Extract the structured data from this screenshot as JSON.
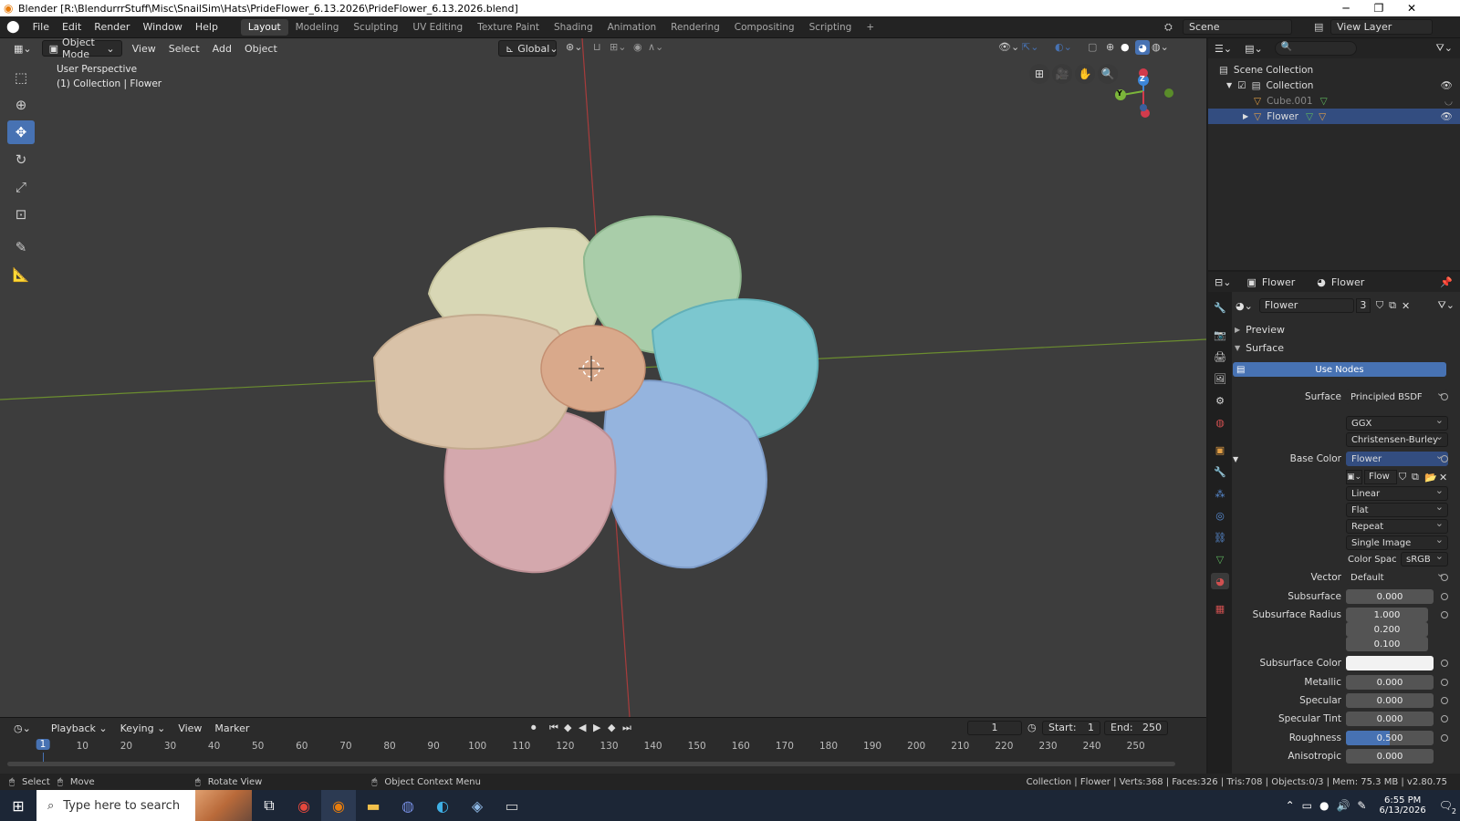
{
  "window": {
    "title": "Blender [R:\\BlendurrrStuff\\Misc\\SnailSim\\Hats\\PrideFlower_6.13.2026\\PrideFlower_6.13.2026.blend]",
    "minimize": "─",
    "maximize": "❐",
    "close": "✕"
  },
  "menus": [
    "File",
    "Edit",
    "Render",
    "Window",
    "Help"
  ],
  "workspaces": [
    "Layout",
    "Modeling",
    "Sculpting",
    "UV Editing",
    "Texture Paint",
    "Shading",
    "Animation",
    "Rendering",
    "Compositing",
    "Scripting"
  ],
  "add_workspace": "+",
  "scene_label": "Scene",
  "view_layer_label": "View Layer",
  "viewport": {
    "mode": "Object Mode",
    "menus": [
      "View",
      "Select",
      "Add",
      "Object"
    ],
    "transform_orientation": "Global",
    "overlay_line1": "User Perspective",
    "overlay_line2": "(1) Collection | Flower",
    "gizmo": {
      "z": "Z",
      "y": "Y"
    }
  },
  "outliner": {
    "rows": [
      {
        "label": "Scene Collection"
      },
      {
        "label": "Collection"
      },
      {
        "label": "Cube.001"
      },
      {
        "label": "Flower"
      }
    ]
  },
  "properties": {
    "object_name": "Flower",
    "material_name": "Flower",
    "slot_name": "Flower",
    "user_count": "3",
    "preview_label": "Preview",
    "surface_panel": "Surface",
    "use_nodes": "Use Nodes",
    "fields": {
      "surface_label": "Surface",
      "surface_value": "Principled BSDF",
      "distribution": "GGX",
      "subsurface_method": "Christensen-Burley",
      "base_color_label": "Base Color",
      "base_color_value": "Flower",
      "image_name": "Flow",
      "interpolation": "Linear",
      "projection": "Flat",
      "extension": "Repeat",
      "source": "Single Image",
      "color_space_label": "Color Spac",
      "color_space_value": "sRGB",
      "vector_label": "Vector",
      "vector_value": "Default",
      "subsurface_label": "Subsurface",
      "subsurface_value": "0.000",
      "subsurface_radius_label": "Subsurface Radius",
      "radius_1": "1.000",
      "radius_2": "0.200",
      "radius_3": "0.100",
      "subsurface_color_label": "Subsurface Color",
      "metallic_label": "Metallic",
      "metallic_value": "0.000",
      "specular_label": "Specular",
      "specular_value": "0.000",
      "specular_tint_label": "Specular Tint",
      "specular_tint_value": "0.000",
      "roughness_label": "Roughness",
      "roughness_value": "0.500",
      "anisotropic_label": "Anisotropic",
      "anisotropic_value": "0.000"
    },
    "roughness_fraction": 0.5
  },
  "timeline": {
    "menus": [
      "Playback",
      "Keying",
      "View",
      "Marker"
    ],
    "current_frame": "1",
    "start_label": "Start:",
    "start_value": "1",
    "end_label": "End:",
    "end_value": "250",
    "ruler": [
      "10",
      "20",
      "30",
      "40",
      "50",
      "60",
      "70",
      "80",
      "90",
      "100",
      "110",
      "120",
      "130",
      "140",
      "150",
      "160",
      "170",
      "180",
      "190",
      "200",
      "210",
      "220",
      "230",
      "240",
      "250"
    ],
    "playhead": "1"
  },
  "statusbar": {
    "select": "Select",
    "move": "Move",
    "rotate": "Rotate View",
    "context": "Object Context Menu",
    "stats": "Collection | Flower | Verts:368 | Faces:326 | Tris:708 | Objects:0/3 | Mem: 75.3 MB | v2.80.75"
  },
  "taskbar": {
    "search_placeholder": "Type here to search",
    "time": "6:55 PM",
    "date": "6/13/2026",
    "notification_count": "2"
  },
  "colors": {
    "accent": "#4772b3",
    "petal_yellow": "#d8d7b5",
    "petal_green": "#a9cda9",
    "petal_cyan": "#7cc7cf",
    "petal_blue": "#95b4de",
    "petal_pink": "#d4a8ad",
    "petal_peach": "#d9c2a8",
    "center": "#d9a98b"
  }
}
